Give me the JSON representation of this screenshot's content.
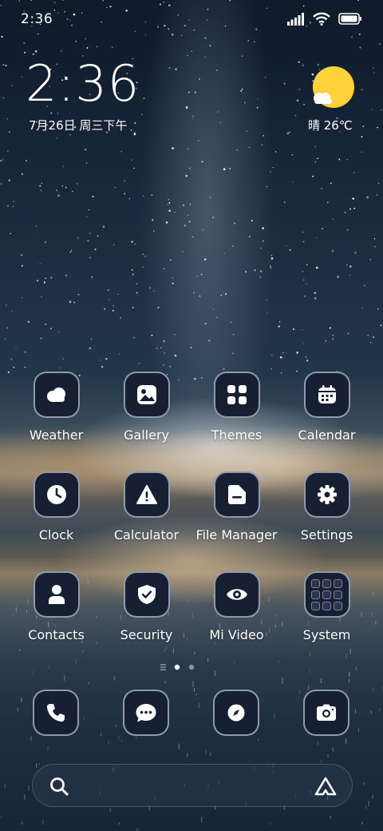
{
  "status_bar": {
    "time": "2:36"
  },
  "clock_widget": {
    "time": "2:36",
    "date": "7月26日 周三下午"
  },
  "weather_widget": {
    "text": "晴 26℃"
  },
  "apps": [
    {
      "label": "Weather",
      "icon": "weather-icon"
    },
    {
      "label": "Gallery",
      "icon": "gallery-icon"
    },
    {
      "label": "Themes",
      "icon": "themes-icon"
    },
    {
      "label": "Calendar",
      "icon": "calendar-icon"
    },
    {
      "label": "Clock",
      "icon": "clock-icon"
    },
    {
      "label": "Calculator",
      "icon": "calculator-icon"
    },
    {
      "label": "File Manager",
      "icon": "file-manager-icon"
    },
    {
      "label": "Settings",
      "icon": "settings-icon"
    },
    {
      "label": "Contacts",
      "icon": "contacts-icon"
    },
    {
      "label": "Security",
      "icon": "security-icon"
    },
    {
      "label": "Mi Video",
      "icon": "mi-video-icon"
    },
    {
      "label": "System",
      "icon": "system-folder-icon"
    }
  ],
  "page_indicator": {
    "pages": 2,
    "current": 1
  },
  "dock": [
    {
      "icon": "phone-icon"
    },
    {
      "icon": "messages-icon"
    },
    {
      "icon": "browser-icon"
    },
    {
      "icon": "camera-icon"
    }
  ],
  "colors": {
    "icon_background": "#172033",
    "sun": "#ffd23a",
    "text": "#ffffff"
  }
}
